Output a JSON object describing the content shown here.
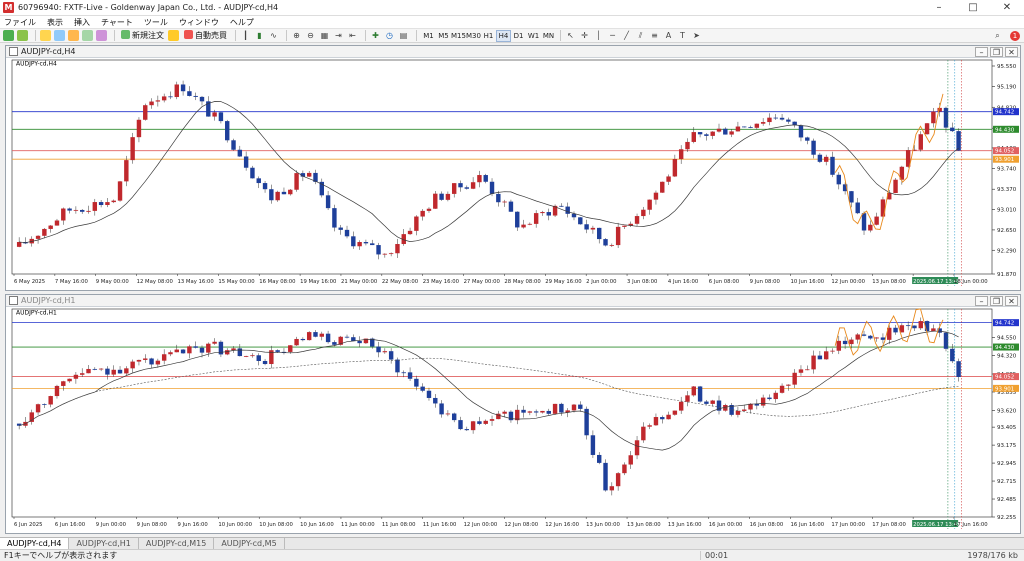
{
  "window": {
    "title": "60796940: FXTF-Live - Goldenway Japan Co., Ltd. - AUDJPY-cd,H4"
  },
  "menu": [
    "ファイル",
    "表示",
    "挿入",
    "チャート",
    "ツール",
    "ウィンドウ",
    "ヘルプ"
  ],
  "toolbar": {
    "new_order": "新規注文",
    "auto_trade": "自動売買",
    "timeframes": [
      "M1",
      "M5",
      "M15",
      "M30",
      "H1",
      "H4",
      "D1",
      "W1",
      "MN"
    ],
    "active_timeframe": "H4"
  },
  "charts": [
    {
      "title": "AUDJPY-cd,H4",
      "label": "AUDJPY-cd,H4",
      "price_min": 91.87,
      "price_max": 95.55,
      "ticks": [
        "95.550",
        "95.190",
        "94.820",
        "94.450",
        "94.100",
        "93.740",
        "93.370",
        "93.010",
        "92.650",
        "92.290",
        "91.870"
      ],
      "hlines": [
        {
          "price": 94.742,
          "color": "#2233cc",
          "label": "94.742"
        },
        {
          "price": 94.43,
          "color": "#2e8b2e",
          "label": "94.430"
        },
        {
          "price": 94.052,
          "color": "#e06060",
          "label": "94.052"
        },
        {
          "price": 93.901,
          "color": "#f0a030",
          "label": "93.901"
        }
      ],
      "time_labels": [
        "6 May 2025",
        "7 May 16:00",
        "9 May 00:00",
        "12 May 08:00",
        "13 May 16:00",
        "15 May 00:00",
        "16 May 08:00",
        "19 May 16:00",
        "21 May 00:00",
        "22 May 08:00",
        "23 May 16:00",
        "27 May 00:00",
        "28 May 08:00",
        "29 May 16:00",
        "2 Jun 00:00",
        "3 Jun 08:00",
        "4 Jun 16:00",
        "6 Jun 08:00",
        "9 Jun 08:00",
        "10 Jun 16:00",
        "12 Jun 00:00",
        "13 Jun 08:00",
        "2025.06.17 13:45",
        "18 Jun 00:00"
      ]
    },
    {
      "title": "AUDJPY-cd,H1",
      "label": "AUDJPY-cd,H1",
      "price_min": 92.255,
      "price_max": 94.84,
      "ticks": [
        "94.550",
        "94.320",
        "94.085",
        "93.855",
        "93.620",
        "93.405",
        "93.175",
        "92.945",
        "92.715",
        "92.485",
        "92.255"
      ],
      "hlines": [
        {
          "price": 94.742,
          "color": "#2233cc",
          "label": "94.742"
        },
        {
          "price": 94.43,
          "color": "#2e8b2e",
          "label": "94.430"
        },
        {
          "price": 94.052,
          "color": "#e06060",
          "label": "94.052"
        },
        {
          "price": 93.901,
          "color": "#f0a030",
          "label": "93.901"
        }
      ],
      "time_labels": [
        "6 Jun 2025",
        "6 Jun 16:00",
        "9 Jun 00:00",
        "9 Jun 08:00",
        "9 Jun 16:00",
        "10 Jun 00:00",
        "10 Jun 08:00",
        "10 Jun 16:00",
        "11 Jun 00:00",
        "11 Jun 08:00",
        "11 Jun 16:00",
        "12 Jun 00:00",
        "12 Jun 08:00",
        "12 Jun 16:00",
        "13 Jun 00:00",
        "13 Jun 08:00",
        "13 Jun 16:00",
        "16 Jun 00:00",
        "16 Jun 08:00",
        "16 Jun 16:00",
        "17 Jun 00:00",
        "17 Jun 08:00",
        "2025.06.17 13:45",
        "17 Jun 16:00"
      ]
    }
  ],
  "tabs": [
    "AUDJPY-cd,H4",
    "AUDJPY-cd,H1",
    "AUDJPY-cd,M15",
    "AUDJPY-cd,M5"
  ],
  "active_tab": "AUDJPY-cd,H4",
  "status": {
    "help": "F1キーでヘルプが表示されます",
    "cell1": "",
    "cell2": "00:01",
    "right": "1978/176 kb"
  },
  "colors": {
    "bull": "#c0282d",
    "bear": "#1e3f9a",
    "ma": "#3a3a3a",
    "fib": "#e8891c"
  }
}
